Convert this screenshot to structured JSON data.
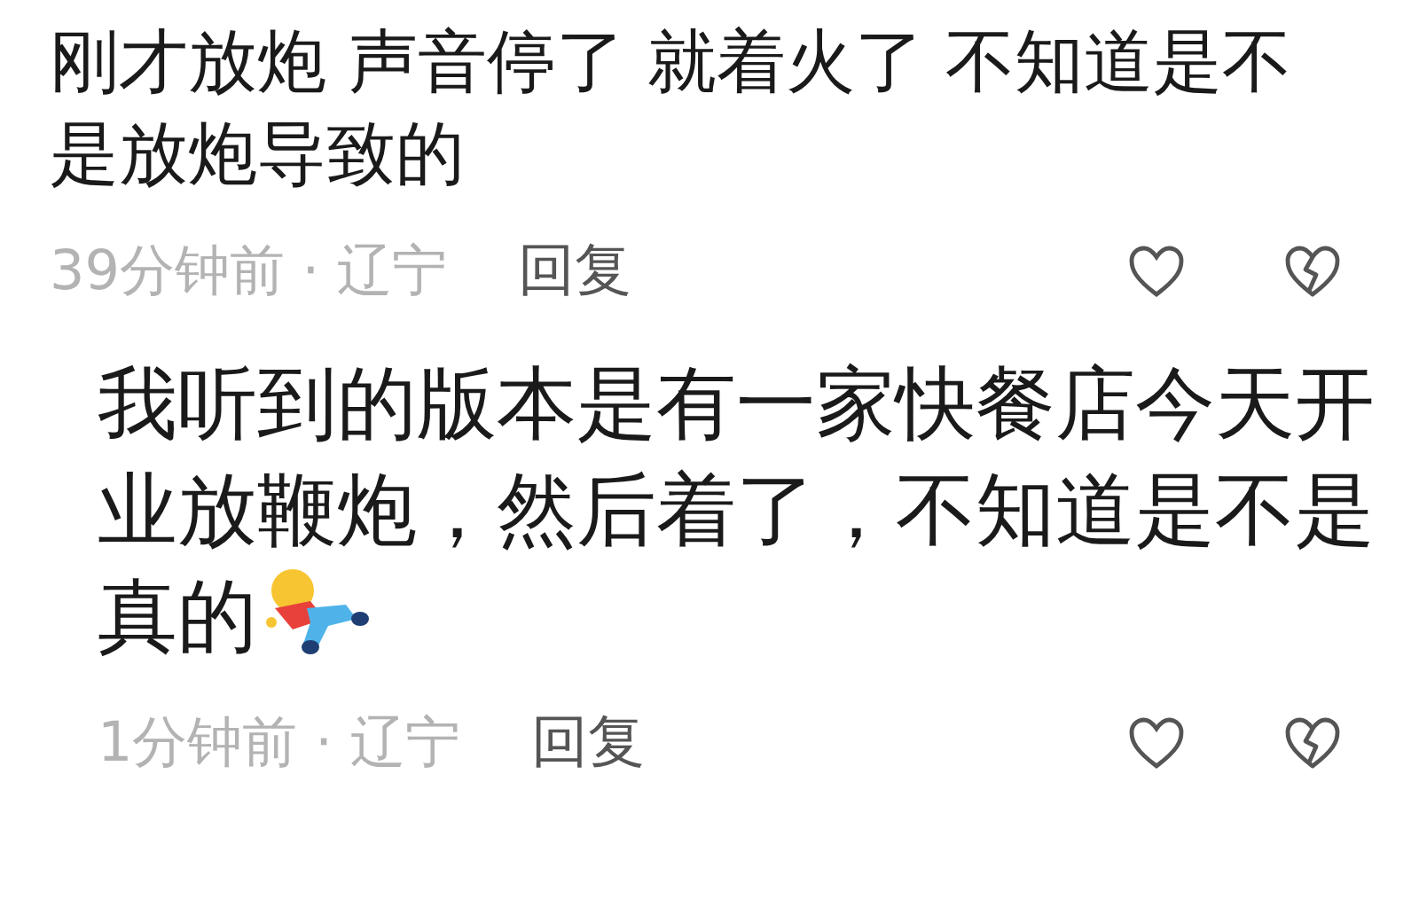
{
  "comments": [
    {
      "text": "刚才放炮 声音停了 就着火了 不知道是不是放炮导致的",
      "meta": "39分钟前 · 辽宁",
      "reply": "回复",
      "emoji": false,
      "nested": false
    },
    {
      "text": "我听到的版本是有一家快餐店今天开业放鞭炮，然后着了，不知道是不是真的",
      "meta": "1分钟前 · 辽宁",
      "reply": "回复",
      "emoji": true,
      "nested": true
    }
  ]
}
